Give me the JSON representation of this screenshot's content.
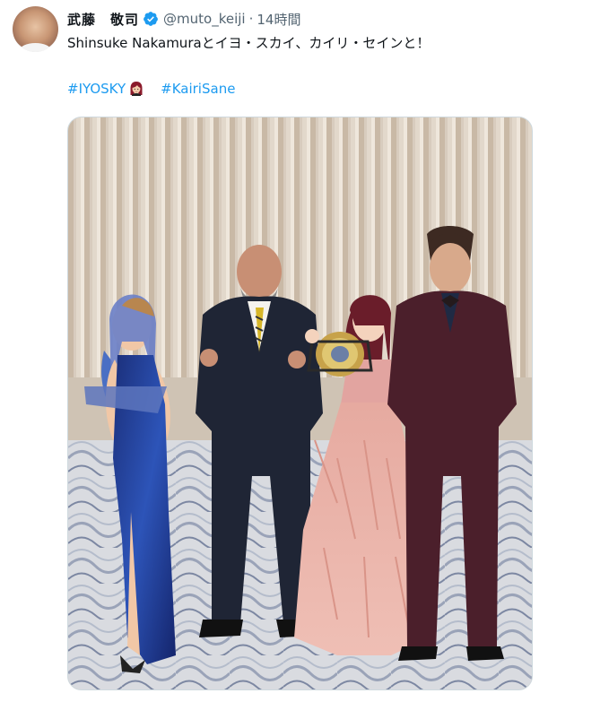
{
  "tweet": {
    "author": {
      "display_name": "武藤　敬司",
      "handle": "@muto_keiji",
      "verified": true,
      "avatar_icon": "profile-photo"
    },
    "separator": "·",
    "time": "14時間",
    "text": "Shinsuke Nakamuraとイヨ・スカイ、カイリ・セインと！",
    "hashtags": [
      {
        "label": "#IYOSKY"
      },
      {
        "label": "#KairiSane"
      }
    ],
    "media": {
      "type": "photo"
    }
  },
  "colors": {
    "link": "#1d9bf0",
    "verified": "#1d9bf0",
    "text": "#0f1419",
    "secondary": "#536471"
  }
}
